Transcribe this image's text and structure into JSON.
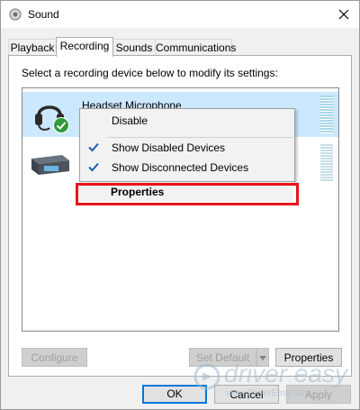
{
  "window": {
    "title": "Sound",
    "icon": "speaker-icon",
    "close_icon": "close-icon"
  },
  "tabs": [
    {
      "label": "Playback",
      "active": false
    },
    {
      "label": "Recording",
      "active": true
    },
    {
      "label": "Sounds",
      "active": false
    },
    {
      "label": "Communications",
      "active": false
    }
  ],
  "panel": {
    "instruction": "Select a recording device below to modify its settings:",
    "devices": [
      {
        "name": "Headset Microphone",
        "icon": "headset-icon",
        "status_icon": "check-badge-icon",
        "selected": true
      },
      {
        "name": "",
        "icon": "line-in-device-icon",
        "selected": false
      }
    ],
    "buttons": {
      "configure": "Configure",
      "set_default": "Set Default",
      "properties": "Properties"
    }
  },
  "context_menu": {
    "items": [
      {
        "label": "Disable",
        "checked": false
      },
      {
        "label": "Show Disabled Devices",
        "checked": true
      },
      {
        "label": "Show Disconnected Devices",
        "checked": true
      },
      {
        "label": "Properties",
        "checked": false,
        "bold": true
      }
    ]
  },
  "dialog_buttons": {
    "ok": "OK",
    "cancel": "Cancel",
    "apply": "Apply"
  },
  "watermark": {
    "brand": "driver easy",
    "url": "www.DriverEasy.com"
  },
  "colors": {
    "selection": "#cce8ff",
    "highlight_box": "#e8141a",
    "default_button_border": "#0078d7"
  }
}
